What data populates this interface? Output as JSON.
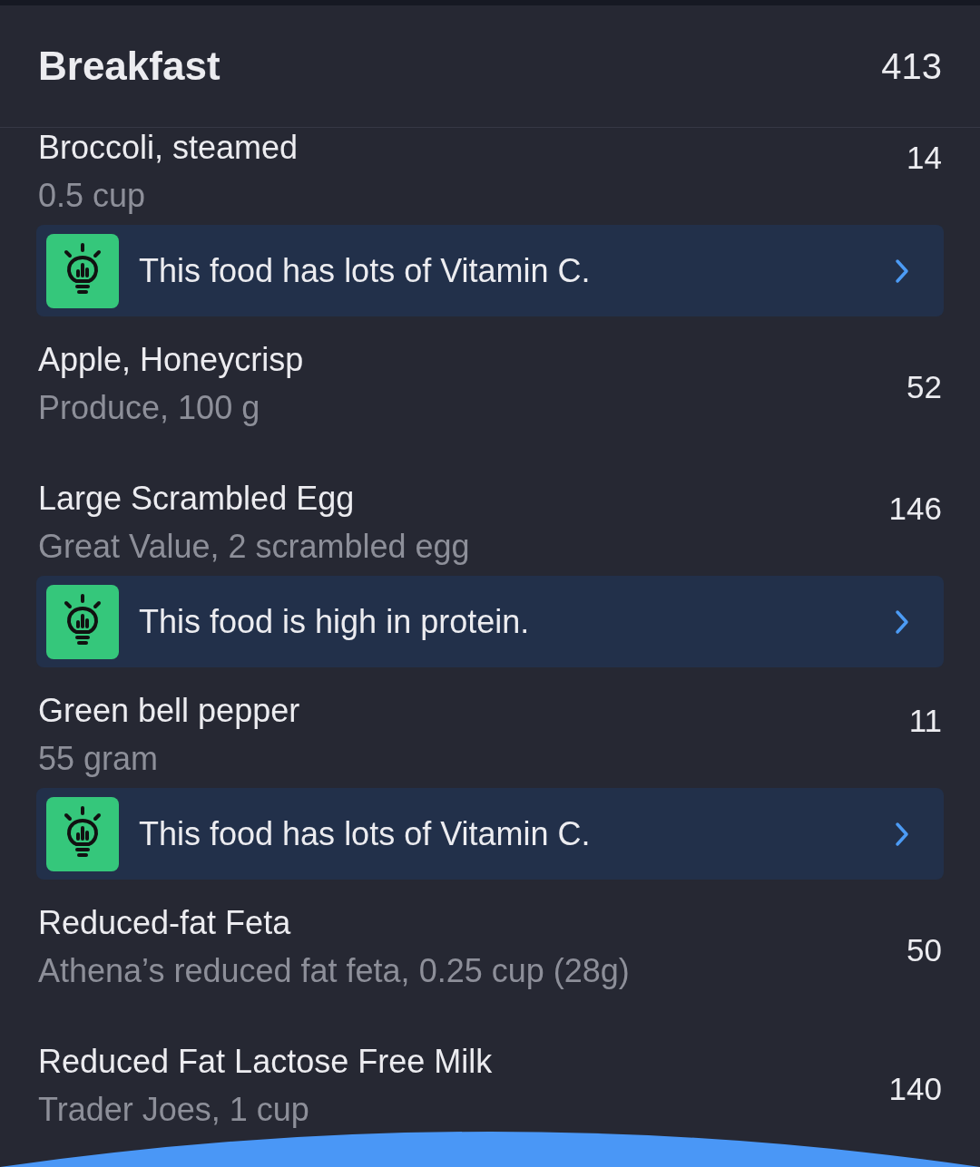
{
  "header": {
    "title": "Breakfast",
    "calories": "413"
  },
  "foods": [
    {
      "name": "Broccoli, steamed",
      "detail": "0.5 cup",
      "calories": "14",
      "tip": {
        "text": "This food has lots of Vitamin C."
      }
    },
    {
      "name": "Apple, Honeycrisp",
      "detail": "Produce, 100 g",
      "calories": "52"
    },
    {
      "name": "Large Scrambled Egg",
      "detail": "Great Value, 2 scrambled egg",
      "calories": "146",
      "tip": {
        "text": "This food is high in protein."
      }
    },
    {
      "name": "Green bell pepper",
      "detail": "55 gram",
      "calories": "11",
      "tip": {
        "text": "This food has lots of Vitamin C."
      }
    },
    {
      "name": "Reduced-fat Feta",
      "detail": "Athena’s reduced fat feta, 0.25 cup (28g)",
      "calories": "50"
    },
    {
      "name": "Reduced Fat Lactose Free Milk",
      "detail": "Trader Joes, 1 cup",
      "calories": "140"
    }
  ]
}
